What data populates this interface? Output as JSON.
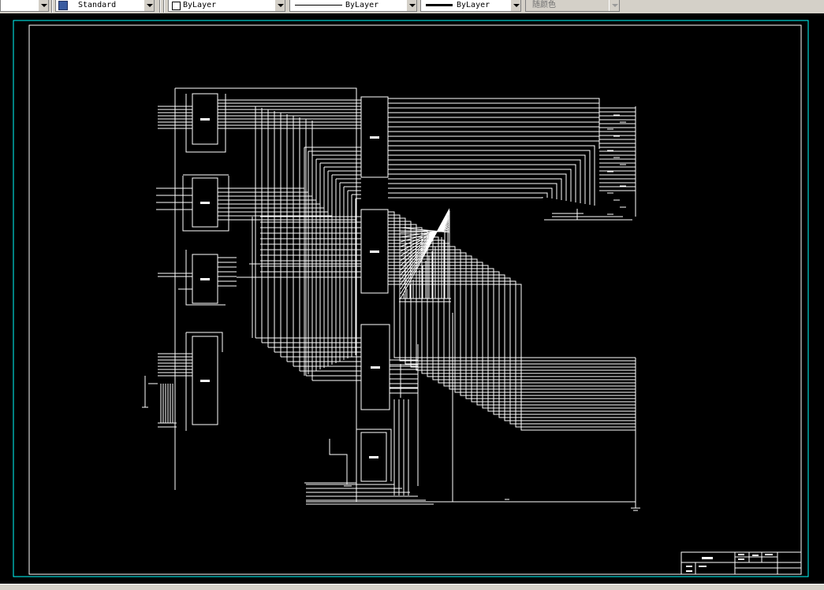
{
  "toolbar": {
    "text_style": "Standard",
    "layer": "ByLayer",
    "linetype": "ByLayer",
    "lineweight": "ByLayer",
    "plot_style": "随颜色"
  },
  "colors": {
    "background": "#000000",
    "line": "#ffffff",
    "frame": "#00ffff",
    "toolbar": "#d4d0c8"
  },
  "icons": {
    "text_style": "text-style-icon",
    "layer_color": "color-swatch-icon",
    "linetype": "line-sample-icon",
    "lineweight": "thick-line-sample-icon"
  }
}
